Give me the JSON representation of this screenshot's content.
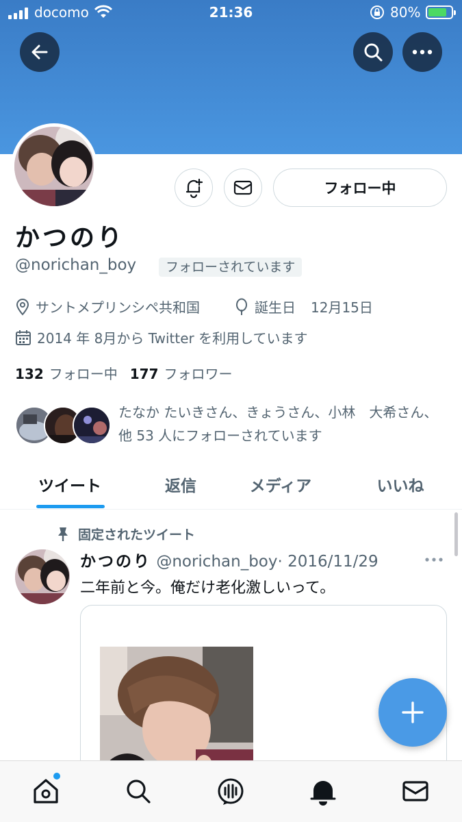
{
  "status_bar": {
    "carrier": "docomo",
    "time": "21:36",
    "battery_percent": "80%",
    "battery_level": 0.8
  },
  "profile": {
    "display_name": "かつのり",
    "handle": "@norichan_boy",
    "follows_you_badge": "フォローされています",
    "follow_button_label": "フォロー中",
    "location": "サントメプリンシペ共和国",
    "birthday_label": "誕生日",
    "birthday_value": "12月15日",
    "joined": "2014 年 8月から Twitter を利用しています",
    "following_count": "132",
    "following_label": "フォロー中",
    "followers_count": "177",
    "followers_label": "フォロワー",
    "followed_by_text": "たなか たいきさん、きょうさん、小林　大希さん、他 53 人にフォローされています"
  },
  "tabs": [
    {
      "label": "ツイート",
      "active": true
    },
    {
      "label": "返信",
      "active": false
    },
    {
      "label": "メディア",
      "active": false
    },
    {
      "label": "いいね",
      "active": false
    }
  ],
  "pinned_tweet": {
    "pinned_label": "固定されたツイート",
    "name": "かつのり",
    "handle": "@norichan_boy",
    "date": "· 2016/11/29",
    "text": "二年前と今。俺だけ老化激しいって。"
  },
  "colors": {
    "accent": "#1d9bf0",
    "banner_top": "#3a7cc6",
    "banner_bottom": "#4a96e0",
    "fab": "#4a9ae6",
    "secondary_text": "#536471"
  },
  "icons": {
    "back": "arrow-left-icon",
    "search": "search-icon",
    "more": "more-horizontal-icon",
    "notify": "bell-plus-icon",
    "message": "envelope-icon",
    "location": "location-pin-icon",
    "birthday": "balloon-icon",
    "calendar": "calendar-icon",
    "pin": "pin-icon",
    "compose": "plus-icon",
    "tabbar": [
      "home-icon",
      "search-icon",
      "spaces-icon",
      "bell-icon",
      "envelope-icon"
    ]
  }
}
